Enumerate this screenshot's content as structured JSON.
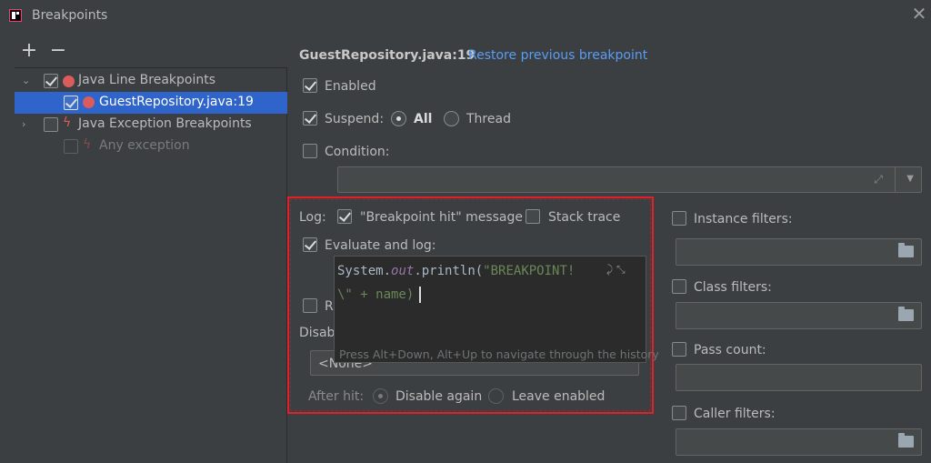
{
  "window": {
    "title": "Breakpoints"
  },
  "toolbar": {
    "add_label": "+",
    "remove_label": "−"
  },
  "tree": {
    "groups": [
      {
        "label": "Java Line Breakpoints",
        "checked": true,
        "icon": "red-dot-icon"
      },
      {
        "label": "GuestRepository.java:19",
        "checked": true,
        "selected": true,
        "icon": "breakpoint-verified-icon"
      },
      {
        "label": "Java Exception Breakpoints",
        "checked": false,
        "icon": "lightning-icon"
      },
      {
        "label": "Any exception",
        "checked": false,
        "disabled": true,
        "icon": "lightning-icon"
      }
    ]
  },
  "details": {
    "file": "GuestRepository.java:19",
    "restore_link": "Restore previous breakpoint",
    "enabled_label": "Enabled",
    "suspend_label": "Suspend:",
    "all_label": "All",
    "thread_label": "Thread",
    "condition_label": "Condition:",
    "log_label": "Log:",
    "breakpoint_hit_label": "\"Breakpoint hit\" message",
    "stack_trace_label": "Stack trace",
    "evaluate_label": "Evaluate and log:",
    "code_line1_a": "System.",
    "code_line1_field": "out",
    "code_line1_b": ".println(",
    "code_line1_str": "\"BREAKPOINT!",
    "code_line2_str": "\\\" + name)",
    "history_hint": "Press Alt+Down, Alt+Up to navigate through the history",
    "remove_label_partial": "R",
    "disable_label_partial": "Disab",
    "select_value": "<None>",
    "after_hit_label": "After hit:",
    "disable_again_label": "Disable again",
    "leave_enabled_label": "Leave enabled",
    "instance_filters_label": "Instance filters:",
    "class_filters_label": "Class filters:",
    "pass_count_label": "Pass count:",
    "caller_filters_label": "Caller filters:"
  },
  "colors": {
    "accent": "#2f65ca",
    "link": "#589df6",
    "highlight_border": "#e0202a",
    "background": "#3c3f41"
  }
}
